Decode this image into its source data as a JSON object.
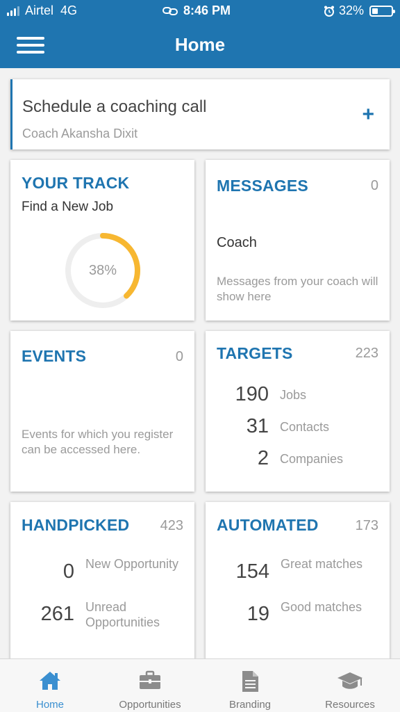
{
  "status_bar": {
    "carrier": "Airtel",
    "network": "4G",
    "time": "8:46 PM",
    "battery": "32%",
    "battery_level": 0.32
  },
  "header": {
    "title": "Home"
  },
  "schedule": {
    "title": "Schedule a coaching call",
    "subtitle": "Coach Akansha Dixit",
    "add_label": "+"
  },
  "track": {
    "title": "YOUR TRACK",
    "subtitle": "Find a New Job",
    "progress_label": "38%",
    "progress": 0.38,
    "accent": "#f7b731"
  },
  "messages": {
    "title": "MESSAGES",
    "count": "0",
    "sender": "Coach",
    "note": "Messages from your coach will show here"
  },
  "events": {
    "title": "EVENTS",
    "count": "0",
    "note": "Events for which you register can be accessed here."
  },
  "targets": {
    "title": "TARGETS",
    "count": "223",
    "rows": [
      {
        "value": "190",
        "label": "Jobs"
      },
      {
        "value": "31",
        "label": "Contacts"
      },
      {
        "value": "2",
        "label": "Companies"
      }
    ]
  },
  "handpicked": {
    "title": "HANDPICKED",
    "count": "423",
    "rows": [
      {
        "value": "0",
        "label": "New Opportunity"
      },
      {
        "value": "261",
        "label": "Unread Opportunities"
      }
    ]
  },
  "automated": {
    "title": "AUTOMATED",
    "count": "173",
    "rows": [
      {
        "value": "154",
        "label": "Great matches"
      },
      {
        "value": "19",
        "label": "Good matches"
      }
    ]
  },
  "tabs": [
    {
      "label": "Home",
      "icon": "home-icon",
      "active": true
    },
    {
      "label": "Opportunities",
      "icon": "briefcase-icon",
      "active": false
    },
    {
      "label": "Branding",
      "icon": "document-icon",
      "active": false
    },
    {
      "label": "Resources",
      "icon": "graduation-cap-icon",
      "active": false
    }
  ],
  "colors": {
    "primary": "#1f75b0",
    "active_tab": "#3a8fd0",
    "progress": "#f7b731",
    "muted_text": "#9a9a9a"
  }
}
